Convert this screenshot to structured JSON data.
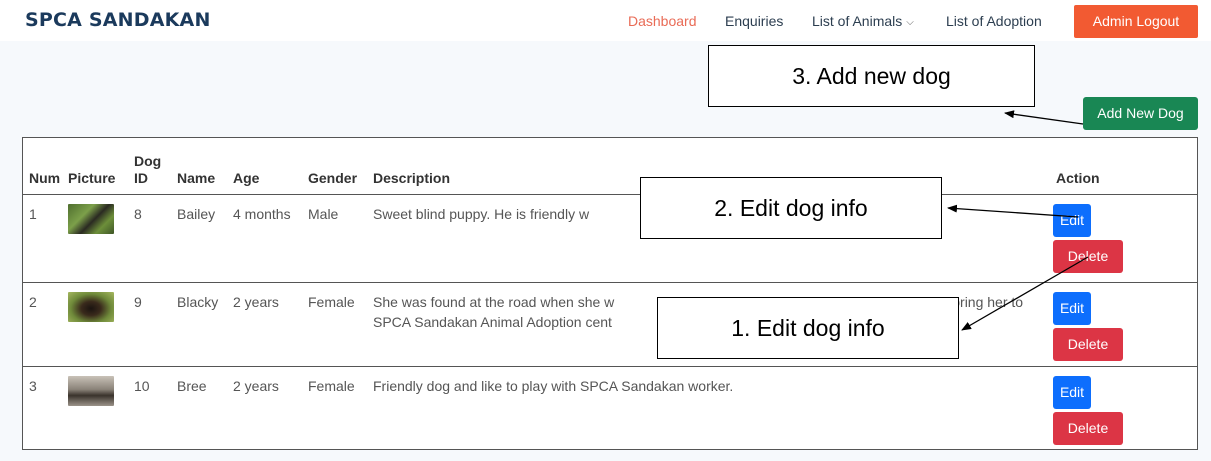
{
  "header": {
    "brand": "SPCA SANDAKAN",
    "nav": {
      "dashboard": "Dashboard",
      "enquiries": "Enquiries",
      "animals": "List of Animals",
      "adoption": "List of Adoption"
    },
    "logout_label": "Admin Logout"
  },
  "toolbar": {
    "add_label": "Add New Dog"
  },
  "table": {
    "headers": {
      "num": "Num",
      "picture": "Picture",
      "dog_id_1": "Dog",
      "dog_id_2": "ID",
      "name": "Name",
      "age": "Age",
      "gender": "Gender",
      "description": "Description",
      "action": "Action"
    },
    "rows": [
      {
        "num": "1",
        "dog_id": "8",
        "name": "Bailey",
        "age": "4 months",
        "gender": "Male",
        "description": "Sweet blind puppy. He is friendly w"
      },
      {
        "num": "2",
        "dog_id": "9",
        "name": "Blacky",
        "age": "2 years",
        "gender": "Female",
        "description": "She was found at the road when she w",
        "description_b": "and bring her to",
        "description_line2": "SPCA Sandakan Animal Adoption cent"
      },
      {
        "num": "3",
        "dog_id": "10",
        "name": "Bree",
        "age": "2 years",
        "gender": "Female",
        "description": "Friendly dog and like to play with SPCA Sandakan worker."
      }
    ],
    "edit_label": "Edit",
    "delete_label": "Delete"
  },
  "annotations": {
    "add_new_dog": "3.   Add new dog",
    "edit_dog_info_top": "2.   Edit dog info",
    "edit_dog_info_bottom": "1.   Edit dog info"
  },
  "colors": {
    "brand": "#1b3a5c",
    "nav_active": "#e96b56",
    "logout": "#f25a32",
    "add_button": "#198754",
    "edit_button": "#0d6efd",
    "delete_button": "#dc3545"
  }
}
